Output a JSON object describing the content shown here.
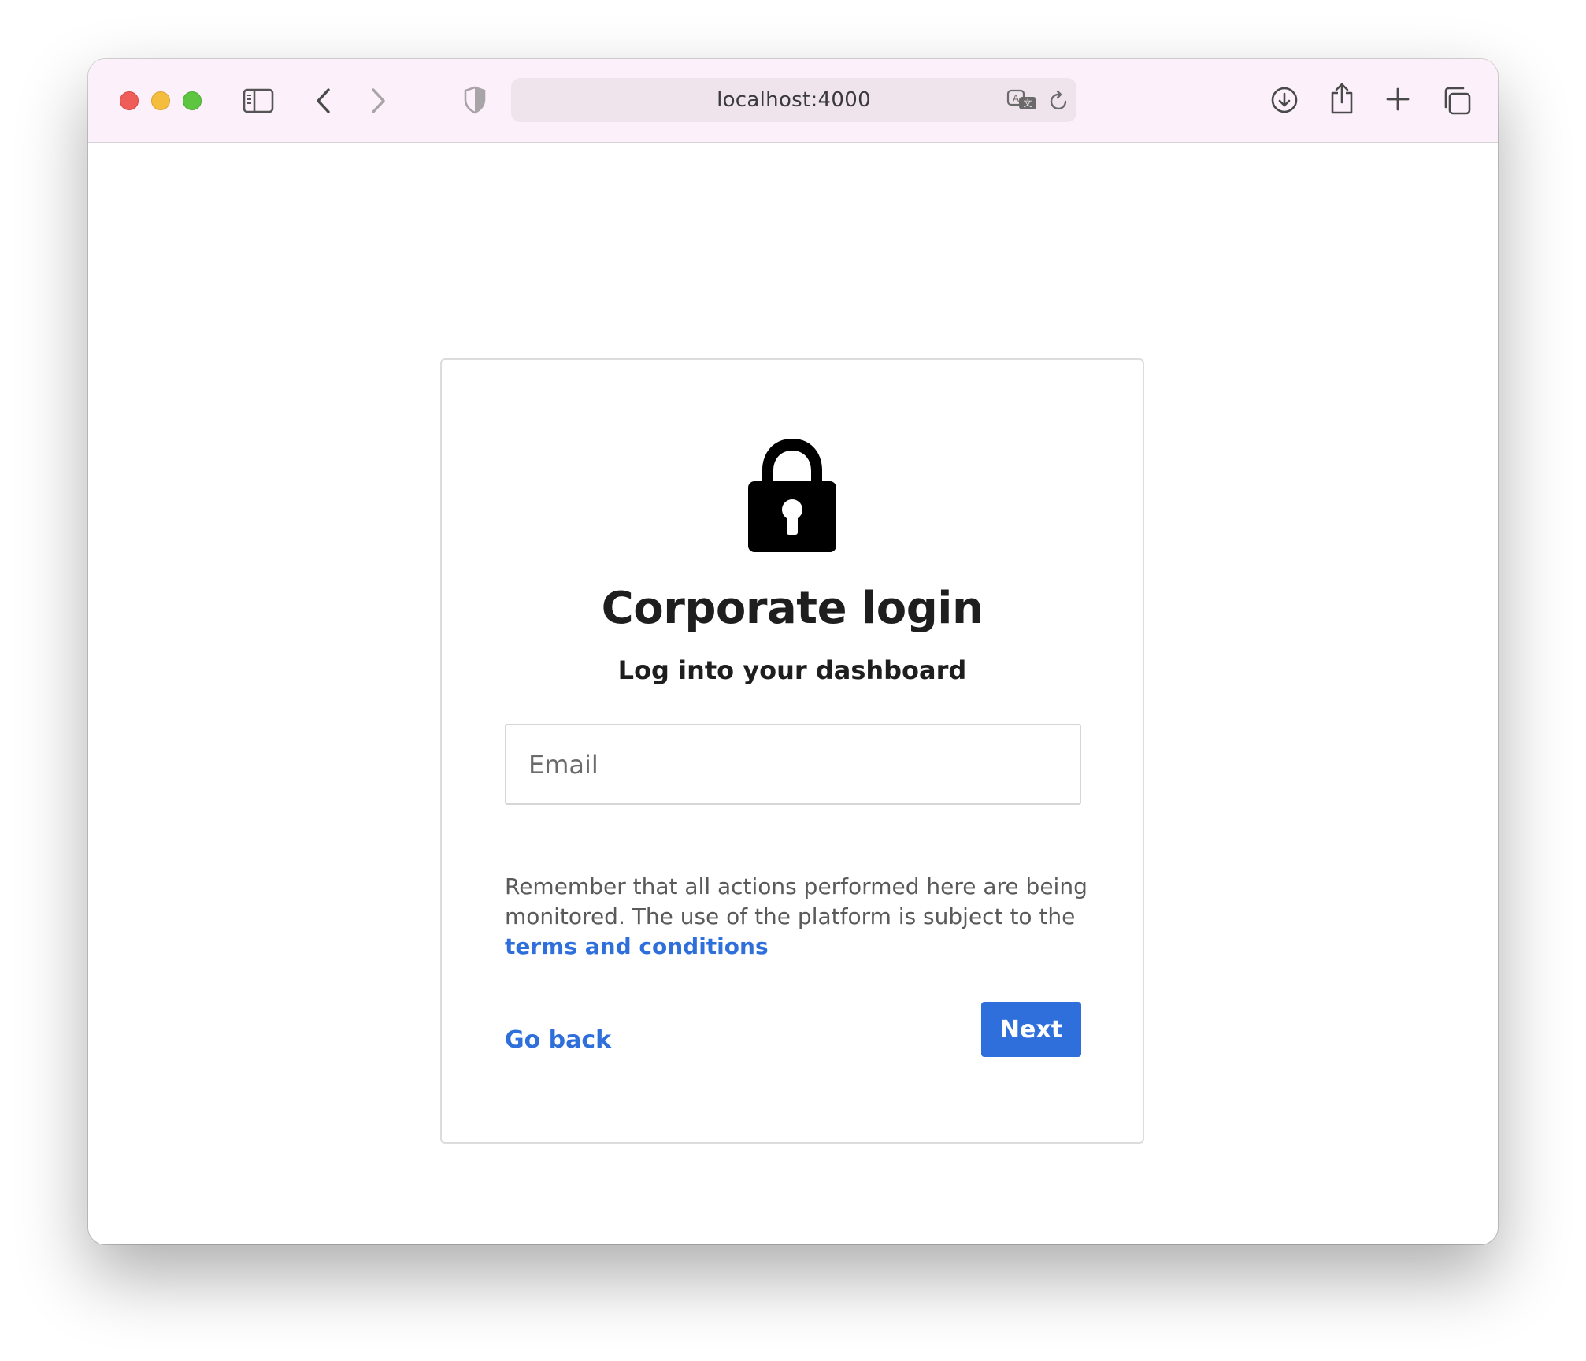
{
  "browser": {
    "url": "localhost:4000",
    "icons": {
      "sidebar": "sidebar-icon",
      "back": "chevron-left-icon",
      "forward": "chevron-right-icon",
      "privacy": "shield-icon",
      "translate": "translate-icon",
      "reload": "reload-icon",
      "downloads": "download-icon",
      "share": "share-icon",
      "new_tab": "plus-icon",
      "tabs": "tabs-overview-icon"
    }
  },
  "login": {
    "icon": "lock-icon",
    "title": "Corporate login",
    "subtitle": "Log into your dashboard",
    "email_placeholder": "Email",
    "email_value": "",
    "notice_text": "Remember that all actions performed here are being monitored. The use of the platform is subject to the ",
    "terms_link": "terms and conditions",
    "go_back": "Go back",
    "next": "Next"
  },
  "colors": {
    "accent": "#2f6fdc",
    "toolbar_bg": "#fcf0fa",
    "url_bar_bg": "#efe3ec",
    "close": "#ee5d58",
    "minimize": "#f5bd3e",
    "zoom": "#5ec541"
  }
}
